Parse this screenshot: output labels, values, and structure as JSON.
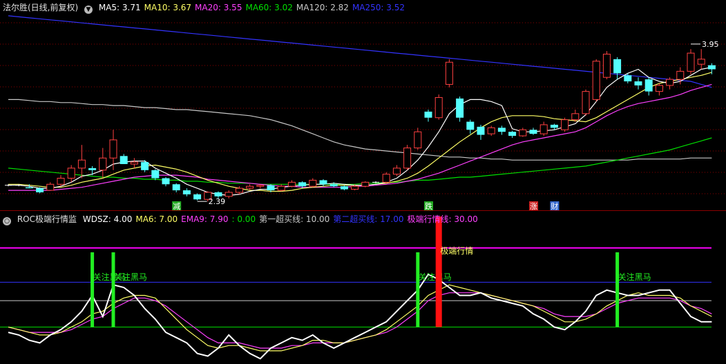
{
  "colors": {
    "background": "#000000",
    "grid": "#8b0000",
    "up": "#ff4040",
    "down": "#54ffff",
    "ma5": "#ffffff",
    "ma10": "#ffff66",
    "ma20": "#ff40ff",
    "ma60": "#00e000",
    "ma120": "#c8c8c8",
    "ma250": "#3333ff",
    "wdsz": "#ffffff",
    "ma6": "#ffff66",
    "ema9": "#ff40ff",
    "line1": "#c8c8c8",
    "line2": "#3333ff",
    "line3": "#ff00ff",
    "signal_green": "#22ee22",
    "signal_red": "#ff1010"
  },
  "main_header": {
    "title": "法尔胜(日线,前复权)",
    "indicators": [
      {
        "label": "MA5: 3.71",
        "color": "#ffffff"
      },
      {
        "label": "MA10: 3.67",
        "color": "#ffff66"
      },
      {
        "label": "MA20: 3.55",
        "color": "#ff40ff"
      },
      {
        "label": "MA60: 3.02",
        "color": "#00e000"
      },
      {
        "label": "MA120: 2.82",
        "color": "#c8c8c8"
      },
      {
        "label": "MA250: 3.52",
        "color": "#3333ff"
      }
    ]
  },
  "sub_header": {
    "title": "ROC极端行情监",
    "indicators": [
      {
        "label": "WDSZ: 4.00",
        "color": "#ffffff"
      },
      {
        "label": "MA6: 7.00",
        "color": "#ffff66"
      },
      {
        "label": "EMA9: 7.90",
        "color": "#ff40ff"
      },
      {
        "label": ": 0.00",
        "color": "#00e000"
      },
      {
        "label": "第一超买线: 10.00",
        "color": "#c8c8c8"
      },
      {
        "label": "第二超买线: 17.00",
        "color": "#3333ff"
      },
      {
        "label": "极端行情线: 30.00",
        "color": "#ff40ff"
      }
    ]
  },
  "price_annotations": {
    "high": "3.95",
    "low": "2.39"
  },
  "event_badges": [
    {
      "text": "减",
      "color": "#22aa22"
    },
    {
      "text": "跌",
      "color": "#22aa22"
    },
    {
      "text": "涨",
      "color": "#cc2222"
    },
    {
      "text": "财",
      "color": "#3366cc"
    }
  ],
  "signal_labels": {
    "watch": "关注黑马",
    "extreme": "极端行情"
  },
  "chart_data": [
    {
      "type": "candlestick",
      "categories_count": 68,
      "ohlc": [
        [
          2.55,
          2.56,
          2.54,
          2.55
        ],
        [
          2.55,
          2.56,
          2.54,
          2.55
        ],
        [
          2.53,
          2.56,
          2.52,
          2.52
        ],
        [
          2.52,
          2.53,
          2.47,
          2.48
        ],
        [
          2.5,
          2.58,
          2.5,
          2.56
        ],
        [
          2.56,
          2.65,
          2.54,
          2.62
        ],
        [
          2.62,
          2.75,
          2.58,
          2.72
        ],
        [
          2.72,
          2.95,
          2.62,
          2.8
        ],
        [
          2.72,
          2.74,
          2.65,
          2.7
        ],
        [
          2.7,
          2.92,
          2.62,
          2.82
        ],
        [
          2.82,
          3.1,
          2.7,
          3.0
        ],
        [
          2.84,
          2.86,
          2.8,
          2.76
        ],
        [
          2.76,
          2.82,
          2.72,
          2.78
        ],
        [
          2.78,
          2.8,
          2.68,
          2.7
        ],
        [
          2.7,
          2.71,
          2.6,
          2.62
        ],
        [
          2.62,
          2.63,
          2.54,
          2.56
        ],
        [
          2.56,
          2.57,
          2.48,
          2.5
        ],
        [
          2.5,
          2.52,
          2.44,
          2.46
        ],
        [
          2.46,
          2.47,
          2.4,
          2.41
        ],
        [
          2.41,
          2.49,
          2.39,
          2.48
        ],
        [
          2.48,
          2.49,
          2.42,
          2.44
        ],
        [
          2.44,
          2.5,
          2.42,
          2.48
        ],
        [
          2.48,
          2.54,
          2.46,
          2.52
        ],
        [
          2.52,
          2.56,
          2.5,
          2.54
        ],
        [
          2.54,
          2.56,
          2.52,
          2.55
        ],
        [
          2.55,
          2.56,
          2.48,
          2.5
        ],
        [
          2.5,
          2.56,
          2.49,
          2.54
        ],
        [
          2.54,
          2.6,
          2.53,
          2.58
        ],
        [
          2.58,
          2.59,
          2.52,
          2.54
        ],
        [
          2.54,
          2.62,
          2.53,
          2.6
        ],
        [
          2.6,
          2.61,
          2.54,
          2.56
        ],
        [
          2.56,
          2.58,
          2.53,
          2.54
        ],
        [
          2.54,
          2.55,
          2.5,
          2.51
        ],
        [
          2.51,
          2.56,
          2.5,
          2.54
        ],
        [
          2.54,
          2.59,
          2.53,
          2.58
        ],
        [
          2.58,
          2.59,
          2.57,
          2.58
        ],
        [
          2.58,
          2.68,
          2.57,
          2.66
        ],
        [
          2.66,
          2.75,
          2.64,
          2.72
        ],
        [
          2.72,
          2.95,
          2.7,
          2.92
        ],
        [
          2.92,
          3.12,
          2.9,
          3.08
        ],
        [
          3.28,
          3.3,
          3.18,
          3.22
        ],
        [
          3.22,
          3.45,
          3.2,
          3.42
        ],
        [
          3.55,
          3.8,
          3.52,
          3.77
        ],
        [
          3.41,
          3.43,
          3.18,
          3.22
        ],
        [
          3.18,
          3.2,
          3.06,
          3.1
        ],
        [
          3.13,
          3.15,
          3.0,
          3.05
        ],
        [
          3.06,
          3.14,
          3.04,
          3.12
        ],
        [
          3.12,
          3.14,
          3.05,
          3.08
        ],
        [
          3.08,
          3.09,
          3.02,
          3.04
        ],
        [
          3.04,
          3.12,
          3.03,
          3.1
        ],
        [
          3.1,
          3.12,
          3.05,
          3.06
        ],
        [
          3.06,
          3.18,
          3.04,
          3.15
        ],
        [
          3.15,
          3.16,
          3.1,
          3.12
        ],
        [
          3.1,
          3.22,
          3.08,
          3.2
        ],
        [
          3.2,
          3.3,
          3.18,
          3.26
        ],
        [
          3.26,
          3.5,
          3.24,
          3.48
        ],
        [
          3.4,
          3.8,
          3.38,
          3.78
        ],
        [
          3.62,
          3.88,
          3.6,
          3.85
        ],
        [
          3.8,
          3.82,
          3.6,
          3.66
        ],
        [
          3.64,
          3.66,
          3.56,
          3.58
        ],
        [
          3.58,
          3.62,
          3.5,
          3.54
        ],
        [
          3.6,
          3.62,
          3.44,
          3.48
        ],
        [
          3.48,
          3.56,
          3.44,
          3.54
        ],
        [
          3.54,
          3.62,
          3.5,
          3.6
        ],
        [
          3.6,
          3.72,
          3.55,
          3.68
        ],
        [
          3.68,
          3.9,
          3.65,
          3.86
        ],
        [
          3.75,
          3.9,
          3.7,
          3.8
        ],
        [
          3.74,
          3.76,
          3.65,
          3.7
        ]
      ],
      "ma5": [
        2.55,
        2.55,
        2.54,
        2.52,
        2.52,
        2.54,
        2.58,
        2.64,
        2.66,
        2.7,
        2.76,
        2.78,
        2.79,
        2.79,
        2.72,
        2.67,
        2.62,
        2.56,
        2.52,
        2.48,
        2.46,
        2.45,
        2.46,
        2.49,
        2.51,
        2.51,
        2.53,
        2.54,
        2.55,
        2.56,
        2.56,
        2.57,
        2.56,
        2.55,
        2.55,
        2.56,
        2.58,
        2.62,
        2.7,
        2.8,
        2.93,
        3.08,
        3.26,
        3.35,
        3.4,
        3.4,
        3.38,
        3.34,
        3.11,
        3.08,
        3.08,
        3.09,
        3.1,
        3.13,
        3.16,
        3.25,
        3.38,
        3.52,
        3.6,
        3.66,
        3.7,
        3.62,
        3.58,
        3.56,
        3.58,
        3.64,
        3.7,
        3.72
      ],
      "ma10": [
        2.56,
        2.56,
        2.55,
        2.54,
        2.53,
        2.53,
        2.55,
        2.58,
        2.6,
        2.62,
        2.66,
        2.7,
        2.72,
        2.74,
        2.75,
        2.73,
        2.71,
        2.68,
        2.64,
        2.6,
        2.57,
        2.54,
        2.52,
        2.5,
        2.5,
        2.49,
        2.49,
        2.5,
        2.52,
        2.53,
        2.54,
        2.55,
        2.55,
        2.55,
        2.55,
        2.56,
        2.57,
        2.59,
        2.62,
        2.67,
        2.74,
        2.82,
        2.9,
        2.98,
        3.05,
        3.12,
        3.18,
        3.22,
        3.24,
        3.24,
        3.24,
        3.23,
        3.21,
        3.2,
        3.19,
        3.18,
        3.22,
        3.28,
        3.34,
        3.4,
        3.46,
        3.52,
        3.56,
        3.58,
        3.6,
        3.62,
        3.64,
        3.67
      ],
      "ma20": [
        2.5,
        2.5,
        2.5,
        2.5,
        2.5,
        2.51,
        2.52,
        2.53,
        2.55,
        2.57,
        2.59,
        2.61,
        2.63,
        2.64,
        2.65,
        2.65,
        2.65,
        2.64,
        2.63,
        2.61,
        2.6,
        2.59,
        2.58,
        2.57,
        2.56,
        2.55,
        2.54,
        2.54,
        2.53,
        2.53,
        2.53,
        2.53,
        2.53,
        2.54,
        2.54,
        2.55,
        2.56,
        2.57,
        2.59,
        2.61,
        2.64,
        2.67,
        2.71,
        2.75,
        2.79,
        2.83,
        2.87,
        2.91,
        2.95,
        2.98,
        3.0,
        3.02,
        3.04,
        3.06,
        3.08,
        3.12,
        3.18,
        3.24,
        3.29,
        3.33,
        3.36,
        3.38,
        3.4,
        3.42,
        3.45,
        3.49,
        3.52,
        3.55
      ],
      "ma60": [
        2.72,
        2.71,
        2.7,
        2.69,
        2.68,
        2.67,
        2.66,
        2.65,
        2.64,
        2.63,
        2.63,
        2.62,
        2.62,
        2.61,
        2.61,
        2.6,
        2.6,
        2.59,
        2.59,
        2.58,
        2.58,
        2.57,
        2.57,
        2.57,
        2.56,
        2.56,
        2.56,
        2.56,
        2.56,
        2.56,
        2.56,
        2.56,
        2.56,
        2.56,
        2.57,
        2.57,
        2.58,
        2.58,
        2.59,
        2.6,
        2.6,
        2.61,
        2.62,
        2.63,
        2.63,
        2.64,
        2.65,
        2.66,
        2.67,
        2.68,
        2.69,
        2.7,
        2.71,
        2.72,
        2.73,
        2.74,
        2.76,
        2.78,
        2.8,
        2.82,
        2.84,
        2.86,
        2.88,
        2.9,
        2.93,
        2.96,
        2.99,
        3.02
      ],
      "ma120": [
        3.4,
        3.4,
        3.39,
        3.38,
        3.38,
        3.37,
        3.37,
        3.36,
        3.35,
        3.35,
        3.34,
        3.34,
        3.33,
        3.32,
        3.32,
        3.31,
        3.3,
        3.3,
        3.29,
        3.28,
        3.27,
        3.26,
        3.25,
        3.24,
        3.22,
        3.2,
        3.17,
        3.14,
        3.1,
        3.06,
        3.02,
        2.98,
        2.95,
        2.93,
        2.91,
        2.9,
        2.89,
        2.88,
        2.87,
        2.86,
        2.85,
        2.84,
        2.83,
        2.83,
        2.82,
        2.82,
        2.81,
        2.81,
        2.8,
        2.8,
        2.8,
        2.8,
        2.8,
        2.8,
        2.8,
        2.8,
        2.8,
        2.8,
        2.8,
        2.8,
        2.81,
        2.81,
        2.81,
        2.81,
        2.81,
        2.82,
        2.82,
        2.82
      ],
      "ma250": [
        4.23,
        4.22,
        4.21,
        4.2,
        4.19,
        4.18,
        4.17,
        4.16,
        4.15,
        4.14,
        4.13,
        4.12,
        4.11,
        4.1,
        4.09,
        4.08,
        4.07,
        4.06,
        4.05,
        4.04,
        4.03,
        4.02,
        4.01,
        4.0,
        3.99,
        3.98,
        3.97,
        3.96,
        3.95,
        3.94,
        3.93,
        3.92,
        3.91,
        3.9,
        3.89,
        3.88,
        3.87,
        3.86,
        3.85,
        3.84,
        3.83,
        3.82,
        3.81,
        3.8,
        3.79,
        3.78,
        3.77,
        3.76,
        3.75,
        3.74,
        3.73,
        3.72,
        3.71,
        3.7,
        3.69,
        3.68,
        3.67,
        3.66,
        3.65,
        3.64,
        3.63,
        3.62,
        3.61,
        3.6,
        3.59,
        3.58,
        3.55,
        3.52
      ],
      "ylim": [
        2.35,
        4.25
      ],
      "high_marker": {
        "index": 65,
        "value": 3.95
      },
      "low_marker": {
        "index": 18,
        "value": 2.39
      },
      "events": [
        {
          "index": 16,
          "badge": 0
        },
        {
          "index": 40,
          "badge": 1
        },
        {
          "index": 50,
          "badge": 2
        },
        {
          "index": 52,
          "badge": 3
        }
      ]
    },
    {
      "type": "line",
      "wdsz": [
        -2,
        -3,
        -5,
        -6,
        -3,
        -1,
        2,
        6,
        12,
        4,
        16,
        15,
        12,
        7,
        3,
        -2,
        -4,
        -6,
        -10,
        -11,
        -8,
        -3,
        -7,
        -10,
        -12,
        -8,
        -6,
        -4,
        -5,
        -3,
        -6,
        -8,
        -6,
        -4,
        -2,
        0,
        2,
        6,
        10,
        14,
        20,
        18,
        15,
        12,
        12,
        13,
        11,
        10,
        9,
        8,
        5,
        3,
        0,
        -1,
        2,
        6,
        12,
        14,
        13,
        12,
        12,
        13,
        14,
        14,
        9,
        4,
        2,
        2
      ],
      "ma6": [
        0,
        -1,
        -2,
        -3,
        -3,
        -2,
        0,
        2,
        5,
        6,
        9,
        11,
        12,
        12,
        11,
        7,
        3,
        -1,
        -4,
        -7,
        -8,
        -7,
        -7,
        -8,
        -9,
        -9,
        -9,
        -8,
        -7,
        -5,
        -5,
        -6,
        -6,
        -5,
        -4,
        -3,
        -1,
        2,
        5,
        8,
        12,
        14,
        16,
        15,
        14,
        13,
        12,
        11,
        10,
        9,
        8,
        6,
        4,
        2,
        2,
        3,
        5,
        8,
        10,
        12,
        13,
        12,
        12,
        12,
        11,
        8,
        6,
        4
      ],
      "ema9": [
        0,
        -1,
        -2,
        -2,
        -2,
        -2,
        -1,
        1,
        3,
        4,
        7,
        9,
        11,
        11,
        10,
        8,
        5,
        2,
        -1,
        -4,
        -6,
        -6,
        -6,
        -7,
        -8,
        -8,
        -8,
        -7,
        -7,
        -6,
        -6,
        -6,
        -6,
        -5,
        -4,
        -3,
        -2,
        0,
        3,
        6,
        10,
        12,
        13,
        13,
        13,
        13,
        12,
        11,
        10,
        9,
        8,
        7,
        5,
        4,
        4,
        4,
        5,
        7,
        9,
        10,
        11,
        11,
        11,
        11,
        10,
        8,
        7,
        5
      ],
      "levels": {
        "zero": 0,
        "first": 10,
        "second": 17,
        "extreme": 30
      },
      "ylim": [
        -14,
        44
      ],
      "signals": [
        {
          "index": 8,
          "kind": "watch"
        },
        {
          "index": 10,
          "kind": "watch"
        },
        {
          "index": 39,
          "kind": "watch"
        },
        {
          "index": 41,
          "kind": "extreme"
        },
        {
          "index": 58,
          "kind": "watch"
        }
      ]
    }
  ]
}
